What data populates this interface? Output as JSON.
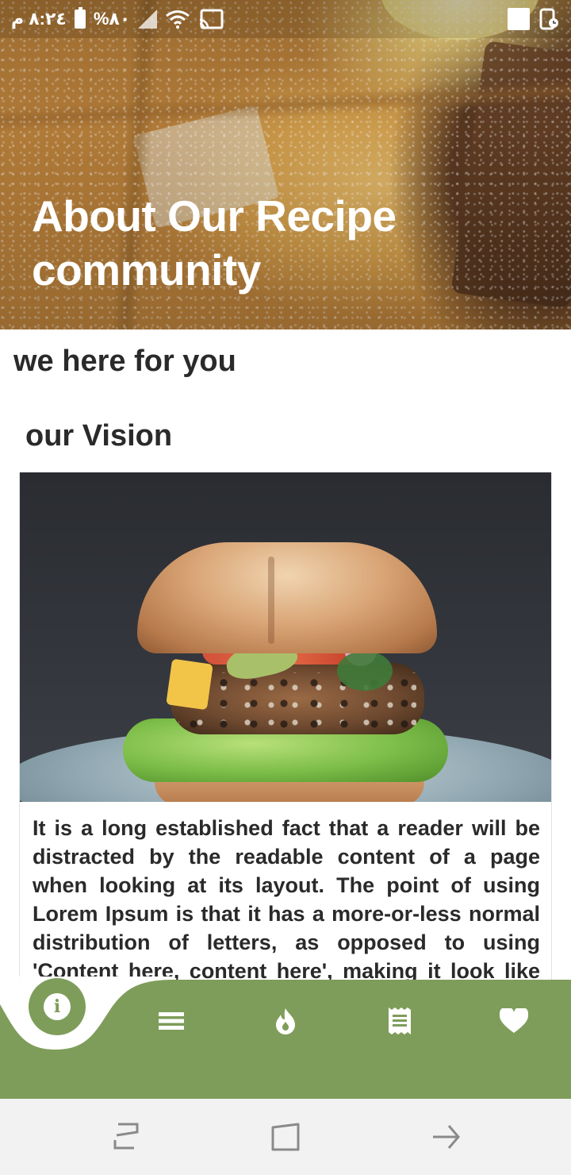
{
  "status_bar": {
    "time": "٨:٢٤ م",
    "battery": "%٨٠",
    "icons": [
      "battery-icon",
      "signal-icon",
      "wifi-icon",
      "cast-icon",
      "square-icon",
      "alarm-icon"
    ]
  },
  "hero": {
    "title": "About Our Recipe community"
  },
  "headline": "we here for you",
  "section": {
    "title": "our Vision",
    "body": "It is a long established fact that a reader will be distracted by the readable content of a page when looking at its layout. The point of using Lorem Ipsum is that it has a more-or-less normal distribution of letters, as opposed to using 'Content here, content here', making it look like readable English."
  },
  "bottom_nav": {
    "items": [
      {
        "icon": "info-icon",
        "active": true
      },
      {
        "icon": "menu-list-icon",
        "active": false
      },
      {
        "icon": "fire-icon",
        "active": false
      },
      {
        "icon": "receipt-icon",
        "active": false
      },
      {
        "icon": "heart-icon",
        "active": false
      }
    ],
    "color": "#7e9d5a"
  },
  "system_nav": {
    "icons": [
      "recent-apps-icon",
      "home-icon",
      "back-icon"
    ]
  }
}
